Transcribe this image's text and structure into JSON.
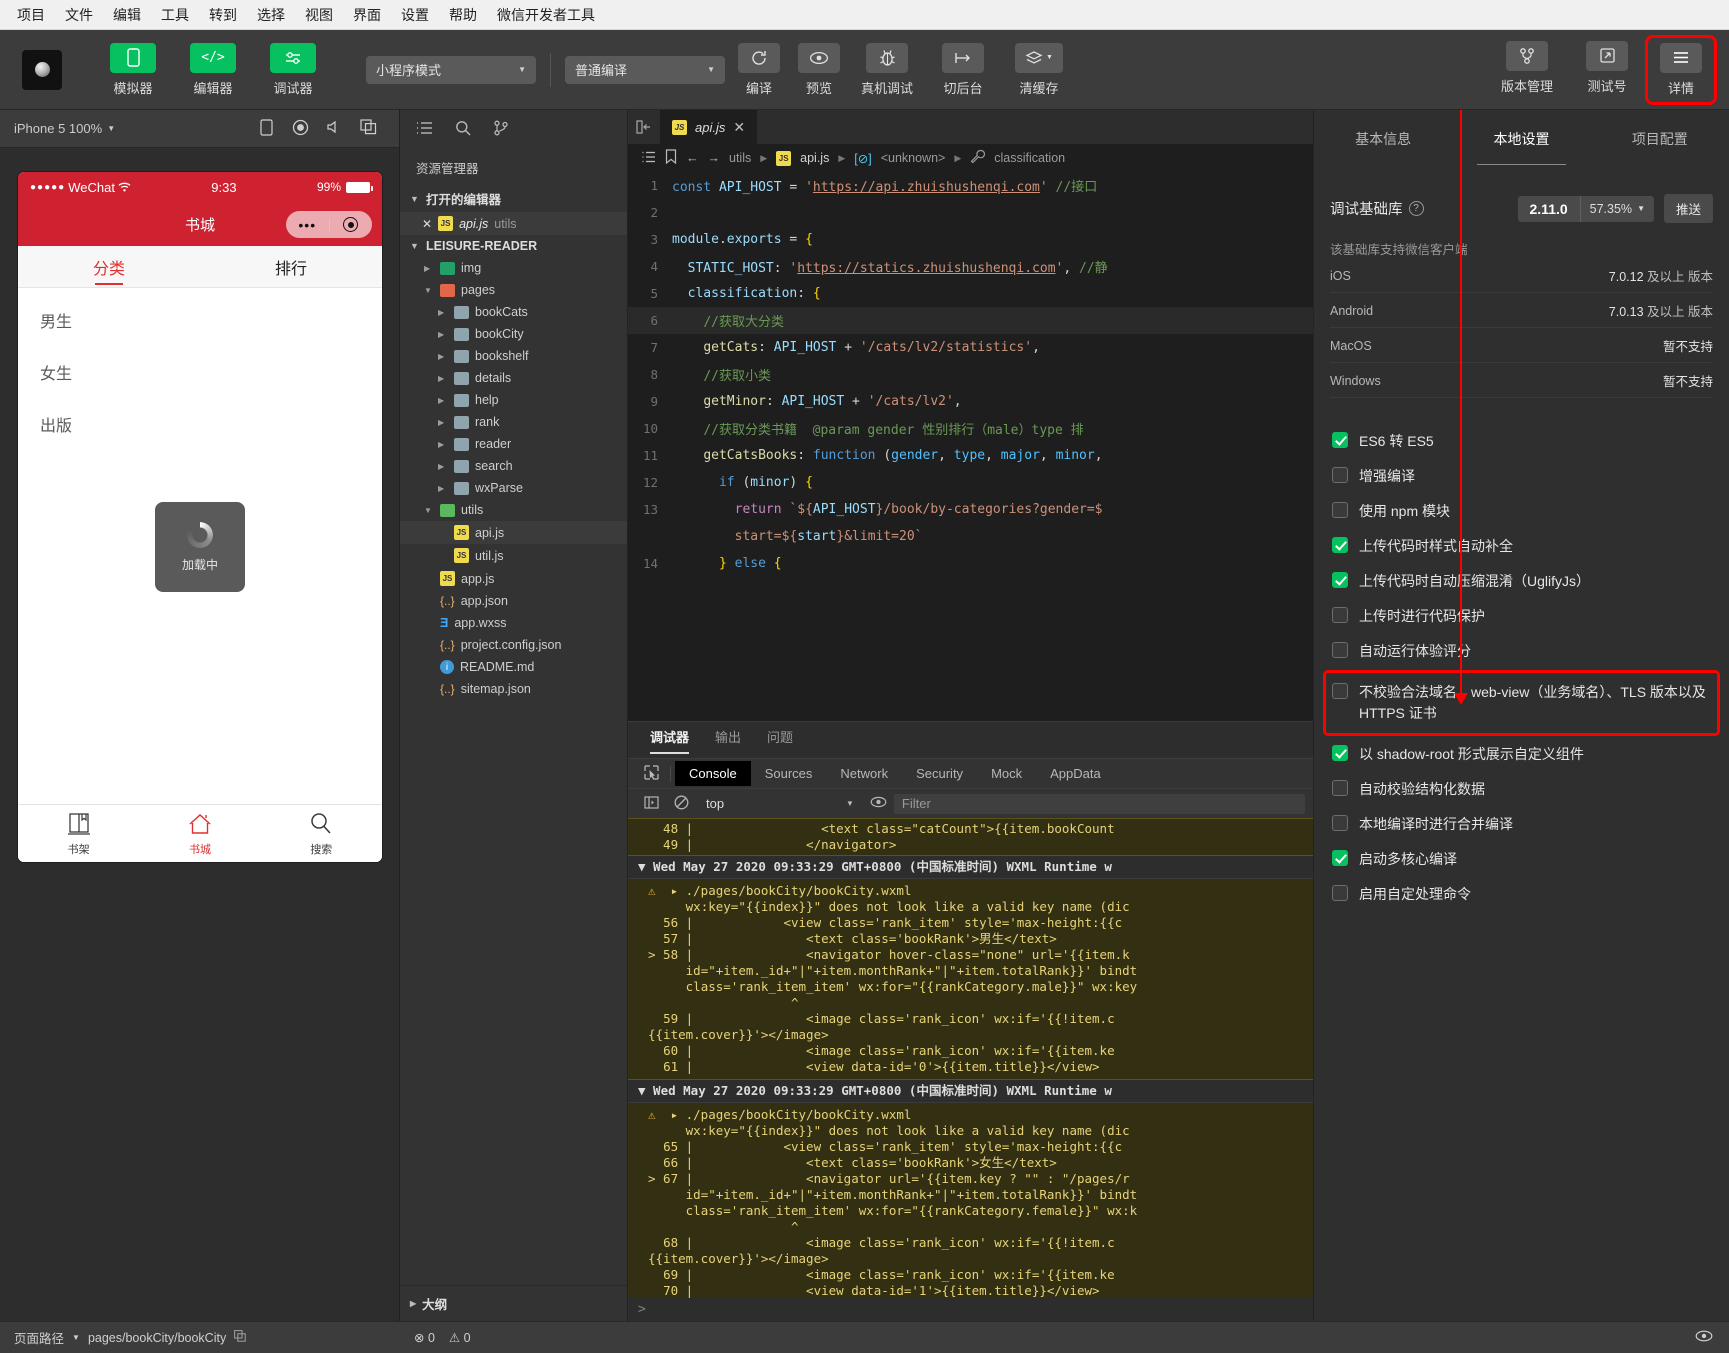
{
  "menubar": [
    "项目",
    "文件",
    "编辑",
    "工具",
    "转到",
    "选择",
    "视图",
    "界面",
    "设置",
    "帮助",
    "微信开发者工具"
  ],
  "toolbar": {
    "mode_select": "小程序模式",
    "compile_select": "普通编译",
    "left_buttons": [
      {
        "label": "模拟器",
        "icon": "phone-icon"
      },
      {
        "label": "编辑器",
        "icon": "code-icon"
      },
      {
        "label": "调试器",
        "icon": "sliders-icon"
      }
    ],
    "center_buttons": [
      {
        "label": "编译",
        "icon": "refresh-icon"
      },
      {
        "label": "预览",
        "icon": "eye-icon"
      },
      {
        "label": "真机调试",
        "icon": "bug-icon"
      },
      {
        "label": "切后台",
        "icon": "background-icon"
      },
      {
        "label": "清缓存",
        "icon": "layers-icon"
      }
    ],
    "right_buttons": [
      {
        "label": "版本管理",
        "icon": "git-branch-icon"
      },
      {
        "label": "测试号",
        "icon": "external-link-icon"
      },
      {
        "label": "详情",
        "icon": "hamburger-icon"
      }
    ]
  },
  "simulator": {
    "device": "iPhone 5 100%",
    "status_bar": {
      "carrier": "WeChat",
      "dots": "●●●●●",
      "time": "9:33",
      "battery": "99%"
    },
    "nav_title": "书城",
    "segments": [
      {
        "label": "分类",
        "active": true
      },
      {
        "label": "排行",
        "active": false
      }
    ],
    "categories": [
      "男生",
      "女生",
      "出版"
    ],
    "loading_text": "加载中",
    "tabs": [
      {
        "label": "书架",
        "icon": "book-icon",
        "active": false
      },
      {
        "label": "书城",
        "icon": "home-icon",
        "active": true
      },
      {
        "label": "搜索",
        "icon": "search-icon",
        "active": false
      }
    ]
  },
  "explorer": {
    "title": "资源管理器",
    "open_editors_label": "打开的编辑器",
    "open_editor": {
      "name": "api.js",
      "folder": "utils"
    },
    "project_name": "LEISURE-READER",
    "tree": [
      {
        "name": "img",
        "type": "folder",
        "depth": 1,
        "icon": "folder-img-icon",
        "open": false
      },
      {
        "name": "pages",
        "type": "folder",
        "depth": 1,
        "icon": "folder-pages-icon",
        "open": true
      },
      {
        "name": "bookCats",
        "type": "folder",
        "depth": 2,
        "icon": "folder-icon",
        "open": false
      },
      {
        "name": "bookCity",
        "type": "folder",
        "depth": 2,
        "icon": "folder-icon",
        "open": false
      },
      {
        "name": "bookshelf",
        "type": "folder",
        "depth": 2,
        "icon": "folder-icon",
        "open": false
      },
      {
        "name": "details",
        "type": "folder",
        "depth": 2,
        "icon": "folder-icon",
        "open": false
      },
      {
        "name": "help",
        "type": "folder",
        "depth": 2,
        "icon": "folder-icon",
        "open": false
      },
      {
        "name": "rank",
        "type": "folder",
        "depth": 2,
        "icon": "folder-icon",
        "open": false
      },
      {
        "name": "reader",
        "type": "folder",
        "depth": 2,
        "icon": "folder-icon",
        "open": false
      },
      {
        "name": "search",
        "type": "folder",
        "depth": 2,
        "icon": "folder-icon",
        "open": false
      },
      {
        "name": "wxParse",
        "type": "folder",
        "depth": 2,
        "icon": "folder-icon",
        "open": false
      },
      {
        "name": "utils",
        "type": "folder",
        "depth": 1,
        "icon": "folder-utils-icon",
        "open": true
      },
      {
        "name": "api.js",
        "type": "js",
        "depth": 2,
        "icon": "js-icon",
        "selected": true
      },
      {
        "name": "util.js",
        "type": "js",
        "depth": 2,
        "icon": "js-icon"
      },
      {
        "name": "app.js",
        "type": "js",
        "depth": 1,
        "icon": "js-icon"
      },
      {
        "name": "app.json",
        "type": "json",
        "depth": 1,
        "icon": "json-icon"
      },
      {
        "name": "app.wxss",
        "type": "wxss",
        "depth": 1,
        "icon": "css-icon"
      },
      {
        "name": "project.config.json",
        "type": "json",
        "depth": 1,
        "icon": "json-icon"
      },
      {
        "name": "README.md",
        "type": "md",
        "depth": 1,
        "icon": "info-icon"
      },
      {
        "name": "sitemap.json",
        "type": "json",
        "depth": 1,
        "icon": "json-icon"
      }
    ],
    "outline_label": "大纲"
  },
  "editor": {
    "tab": {
      "name": "api.js",
      "icon": "js-icon"
    },
    "breadcrumb": [
      "utils",
      "api.js",
      "<unknown>",
      "classification"
    ],
    "lines": [
      {
        "n": 1,
        "html": "<span class=\"kw\">const</span> <span class=\"v\">API_HOST</span> <span class=\"op\">=</span> <span class=\"s\">'<u>https://api.zhuishushenqi.com</u>'</span> <span class=\"cm\">//接口</span>"
      },
      {
        "n": 2,
        "html": ""
      },
      {
        "n": 3,
        "html": "<span class=\"v\">module</span><span class=\"op\">.</span><span class=\"v\">exports</span> <span class=\"op\">=</span> <span class=\"pl\">{</span>"
      },
      {
        "n": 4,
        "html": "  <span class=\"v\">STATIC_HOST</span><span class=\"op\">:</span> <span class=\"s\">'<u>https://statics.zhuishushenqi.com</u>'</span><span class=\"op\">,</span> <span class=\"cm\">//静</span>"
      },
      {
        "n": 5,
        "html": "  <span class=\"v\">classification</span><span class=\"op\">:</span> <span class=\"pl\">{</span>"
      },
      {
        "n": 6,
        "html": "    <span class=\"cm\">//获取大分类</span>",
        "hl": true
      },
      {
        "n": 7,
        "html": "    <span class=\"fn\">getCats</span><span class=\"op\">:</span> <span class=\"v\">API_HOST</span> <span class=\"op\">+</span> <span class=\"s\">'/cats/lv2/statistics'</span><span class=\"op\">,</span>"
      },
      {
        "n": 8,
        "html": "    <span class=\"cm\">//获取小类</span>"
      },
      {
        "n": 9,
        "html": "    <span class=\"fn\">getMinor</span><span class=\"op\">:</span> <span class=\"v\">API_HOST</span> <span class=\"op\">+</span> <span class=\"s\">'/cats/lv2'</span><span class=\"op\">,</span>"
      },
      {
        "n": 10,
        "html": "    <span class=\"cm\">//获取分类书籍  @param gender 性别排行（male）type 排</span>"
      },
      {
        "n": 11,
        "html": "    <span class=\"fn\">getCatsBooks</span><span class=\"op\">:</span> <span class=\"kw\">function</span> <span class=\"op\">(</span><span class=\"pn\">gender</span><span class=\"op\">,</span> <span class=\"pn\">type</span><span class=\"op\">,</span> <span class=\"pn\">major</span><span class=\"op\">,</span> <span class=\"pn\">minor</span><span class=\"op\">,</span>"
      },
      {
        "n": 12,
        "html": "      <span class=\"kw\">if</span> <span class=\"op\">(</span><span class=\"v\">minor</span><span class=\"op\">)</span> <span class=\"pl\">{</span>"
      },
      {
        "n": 13,
        "html": "        <span class=\"k\">return</span> <span class=\"s\">`${</span><span class=\"v\">API_HOST</span><span class=\"s\">}/book/by-categories?gender=$</span>"
      },
      {
        "n": "",
        "html": "        <span class=\"s\">start=${</span><span class=\"v\">start</span><span class=\"s\">}&amp;limit=20`</span>"
      },
      {
        "n": 14,
        "html": "      <span class=\"pl\">}</span> <span class=\"kw\">else</span> <span class=\"pl\">{</span>"
      }
    ]
  },
  "console": {
    "panel_tabs": [
      {
        "label": "调试器",
        "active": true
      },
      {
        "label": "输出",
        "active": false
      },
      {
        "label": "问题",
        "active": false
      }
    ],
    "devtools_tabs": [
      {
        "label": "Console",
        "active": true
      },
      {
        "label": "Sources",
        "active": false
      },
      {
        "label": "Network",
        "active": false
      },
      {
        "label": "Security",
        "active": false
      },
      {
        "label": "Mock",
        "active": false
      },
      {
        "label": "AppData",
        "active": false
      }
    ],
    "context": "top",
    "filter_placeholder": "Filter",
    "entries": [
      {
        "type": "code",
        "lines": [
          "  48 |                 <text class=\"catCount\">{{item.bookCount",
          "  49 |               </navigator>"
        ]
      },
      {
        "type": "timestamp",
        "text": "▼ Wed May 27 2020 09:33:29 GMT+0800 (中国标准时间) WXML Runtime w"
      },
      {
        "type": "warning",
        "lines": [
          "⚠  ▸ ./pages/bookCity/bookCity.wxml",
          "     wx:key=\"{{index}}\" does not look like a valid key name (dic",
          "  56 |            <view class='rank_item' style='max-height:{{c",
          "  57 |               <text class='bookRank'>男生</text>",
          "> 58 |               <navigator hover-class=\"none\" url='{{item.k",
          "     id=\"+item._id+\"|\"+item.monthRank+\"|\"+item.totalRank}}' bindt",
          "     class='rank_item_item' wx:for=\"{{rankCategory.male}}\" wx:key",
          "                   ^",
          "  59 |               <image class='rank_icon' wx:if='{{!item.c",
          "{{item.cover}}'></image>",
          "  60 |               <image class='rank_icon' wx:if='{{item.ke",
          "  61 |               <view data-id='0'>{{item.title}}</view>"
        ]
      },
      {
        "type": "timestamp",
        "text": "▼ Wed May 27 2020 09:33:29 GMT+0800 (中国标准时间) WXML Runtime w"
      },
      {
        "type": "warning",
        "lines": [
          "⚠  ▸ ./pages/bookCity/bookCity.wxml",
          "     wx:key=\"{{index}}\" does not look like a valid key name (dic",
          "  65 |            <view class='rank_item' style='max-height:{{c",
          "  66 |               <text class='bookRank'>女生</text>",
          "> 67 |               <navigator url='{{item.key ? \"\" : \"/pages/r",
          "     id=\"+item._id+\"|\"+item.monthRank+\"|\"+item.totalRank}}' bindt",
          "     class='rank_item_item' wx:for=\"{{rankCategory.female}}\" wx:k",
          "                   ^",
          "  68 |               <image class='rank_icon' wx:if='{{!item.c",
          "{{item.cover}}'></image>",
          "  69 |               <image class='rank_icon' wx:if='{{item.ke",
          "  70 |               <view data-id='1'>{{item.title}}</view>"
        ]
      }
    ]
  },
  "settings": {
    "tabs": [
      {
        "label": "基本信息",
        "active": false
      },
      {
        "label": "本地设置",
        "active": true
      },
      {
        "label": "项目配置",
        "active": false
      }
    ],
    "debug_lib_label": "调试基础库",
    "debug_lib_version": "2.11.0",
    "debug_lib_percent": "57.35%",
    "push_label": "推送",
    "support_note": "该基础库支持微信客户端",
    "platforms": [
      {
        "name": "iOS",
        "version": "7.0.12",
        "suffix": "及以上 版本"
      },
      {
        "name": "Android",
        "version": "7.0.13",
        "suffix": "及以上 版本"
      },
      {
        "name": "MacOS",
        "version": "暂不支持",
        "suffix": ""
      },
      {
        "name": "Windows",
        "version": "暂不支持",
        "suffix": ""
      }
    ],
    "checkboxes": [
      {
        "label": "ES6 转 ES5",
        "checked": true,
        "highlighted": false
      },
      {
        "label": "增强编译",
        "checked": false,
        "highlighted": false
      },
      {
        "label": "使用 npm 模块",
        "checked": false,
        "highlighted": false
      },
      {
        "label": "上传代码时样式自动补全",
        "checked": true,
        "highlighted": false
      },
      {
        "label": "上传代码时自动压缩混淆（UglifyJs）",
        "checked": true,
        "highlighted": false
      },
      {
        "label": "上传时进行代码保护",
        "checked": false,
        "highlighted": false
      },
      {
        "label": "自动运行体验评分",
        "checked": false,
        "highlighted": false
      },
      {
        "label": "不校验合法域名、web-view（业务域名）、TLS 版本以及 HTTPS 证书",
        "checked": false,
        "highlighted": true
      },
      {
        "label": "以 shadow-root 形式展示自定义组件",
        "checked": true,
        "highlighted": false
      },
      {
        "label": "自动校验结构化数据",
        "checked": false,
        "highlighted": false
      },
      {
        "label": "本地编译时进行合并编译",
        "checked": false,
        "highlighted": false
      },
      {
        "label": "启动多核心编译",
        "checked": true,
        "highlighted": false
      },
      {
        "label": "启用自定处理命令",
        "checked": false,
        "highlighted": false
      }
    ]
  },
  "statusbar": {
    "page_path_label": "页面路径",
    "page_path": "pages/bookCity/bookCity",
    "errors": "0",
    "warnings": "0"
  }
}
